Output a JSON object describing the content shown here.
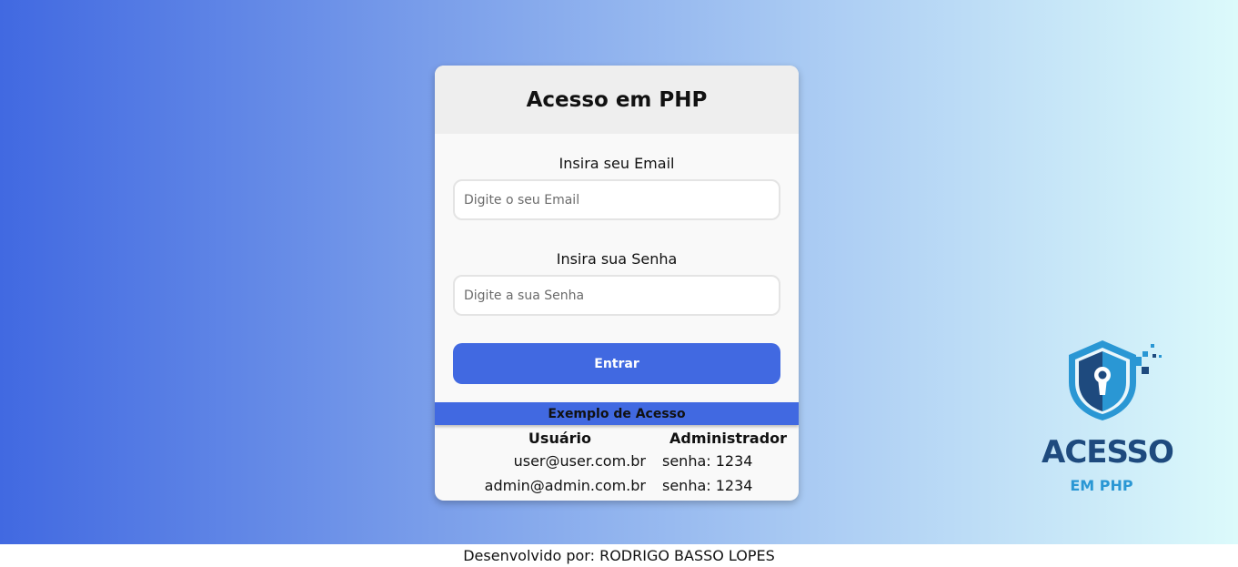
{
  "card": {
    "title": "Acesso em PHP",
    "email_label": "Insira seu Email",
    "email_placeholder": "Digite o seu Email",
    "password_label": "Insira sua Senha",
    "password_placeholder": "Digite a sua Senha",
    "submit_label": "Entrar",
    "example_title": "Exemplo de Acesso",
    "table": {
      "headers": [
        "Usuário",
        "Administrador"
      ],
      "rows": [
        [
          "user@user.com.br",
          "senha: 1234"
        ],
        [
          "admin@admin.com.br",
          "senha: 1234"
        ]
      ]
    }
  },
  "logo": {
    "title": "ACESSO",
    "subtitle": "EM PHP"
  },
  "footer": {
    "text": "Desenvolvido por: RODRIGO BASSO LOPES"
  },
  "colors": {
    "primary": "#4169e1",
    "logo_dark": "#1e4a7e",
    "logo_light": "#2a97d4"
  }
}
